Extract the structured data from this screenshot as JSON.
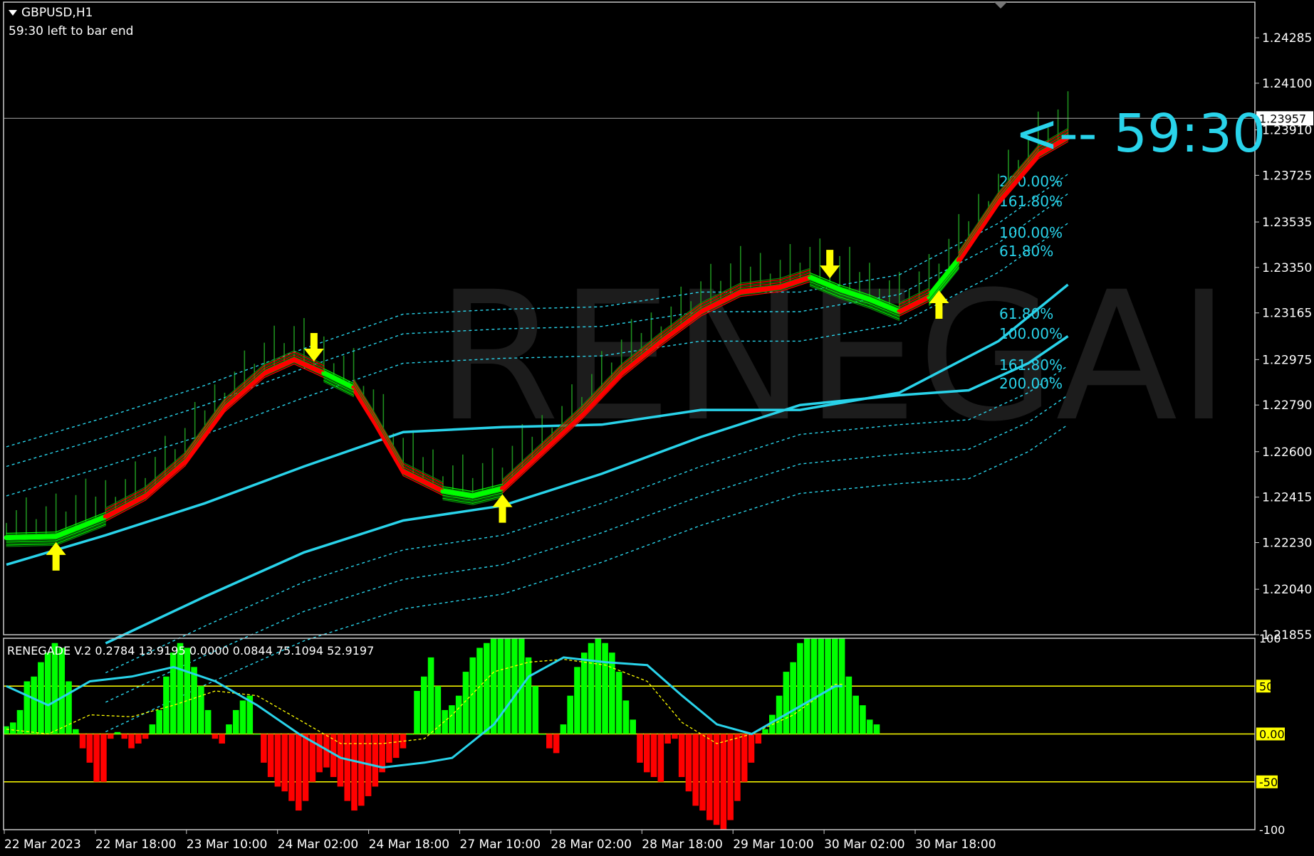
{
  "header": {
    "symbol_label": "GBPUSD,H1",
    "timer_label": "59:30 left to bar end"
  },
  "countdown_label": "<-- 59:30",
  "watermark": "RENEGAI",
  "colors": {
    "background": "#000000",
    "frame": "#c8c8c8",
    "bull": "#00ff00",
    "bear": "#ff0000",
    "band": "#29d3ea",
    "arrow": "#ffff00",
    "level_line": "#ffff00",
    "wick": "#1e8f1e",
    "watermark": "#1c1c1c"
  },
  "chart_data": [
    {
      "type": "line",
      "title": "GBPUSD,H1",
      "ylim": [
        1.21855,
        1.2443
      ],
      "y_ticks": [
        "1.24285",
        "1.24100",
        "1.23910",
        "1.23725",
        "1.23535",
        "1.23350",
        "1.23165",
        "1.22975",
        "1.22790",
        "1.22600",
        "1.22415",
        "1.22230",
        "1.22040",
        "1.21855"
      ],
      "current_price": "1.23957",
      "x_ticks": [
        "22 Mar 2023",
        "22 Mar 18:00",
        "23 Mar 10:00",
        "24 Mar 02:00",
        "24 Mar 18:00",
        "27 Mar 10:00",
        "28 Mar 02:00",
        "28 Mar 18:00",
        "29 Mar 10:00",
        "30 Mar 02:00",
        "30 Mar 18:00"
      ],
      "ribbon": [
        {
          "x": 0,
          "y": 1.2225,
          "trend": "bull"
        },
        {
          "x": 5,
          "y": 1.22255,
          "trend": "bull"
        },
        {
          "x": 10,
          "y": 1.22335,
          "trend": "bear"
        },
        {
          "x": 14,
          "y": 1.2242,
          "trend": "bear"
        },
        {
          "x": 18,
          "y": 1.2256,
          "trend": "bear"
        },
        {
          "x": 22,
          "y": 1.2278,
          "trend": "bear"
        },
        {
          "x": 26,
          "y": 1.2292,
          "trend": "bear"
        },
        {
          "x": 29,
          "y": 1.22975,
          "trend": "bear"
        },
        {
          "x": 32,
          "y": 1.2292,
          "trend": "bull"
        },
        {
          "x": 35,
          "y": 1.2286,
          "trend": "bear"
        },
        {
          "x": 37,
          "y": 1.2273,
          "trend": "bear"
        },
        {
          "x": 40,
          "y": 1.2252,
          "trend": "bear"
        },
        {
          "x": 44,
          "y": 1.2244,
          "trend": "bull"
        },
        {
          "x": 47,
          "y": 1.2242,
          "trend": "bull"
        },
        {
          "x": 50,
          "y": 1.2245,
          "trend": "bear"
        },
        {
          "x": 54,
          "y": 1.226,
          "trend": "bear"
        },
        {
          "x": 58,
          "y": 1.2275,
          "trend": "bear"
        },
        {
          "x": 62,
          "y": 1.2292,
          "trend": "bear"
        },
        {
          "x": 66,
          "y": 1.2305,
          "trend": "bear"
        },
        {
          "x": 70,
          "y": 1.2317,
          "trend": "bear"
        },
        {
          "x": 74,
          "y": 1.2325,
          "trend": "bear"
        },
        {
          "x": 78,
          "y": 1.2327,
          "trend": "bear"
        },
        {
          "x": 81,
          "y": 1.2331,
          "trend": "bull"
        },
        {
          "x": 84,
          "y": 1.2326,
          "trend": "bull"
        },
        {
          "x": 87,
          "y": 1.2322,
          "trend": "bull"
        },
        {
          "x": 90,
          "y": 1.2317,
          "trend": "bear"
        },
        {
          "x": 93,
          "y": 1.2323,
          "trend": "bull"
        },
        {
          "x": 96,
          "y": 1.2338,
          "trend": "bear"
        },
        {
          "x": 100,
          "y": 1.2362,
          "trend": "bear"
        },
        {
          "x": 104,
          "y": 1.2381,
          "trend": "bear"
        },
        {
          "x": 107,
          "y": 1.2388,
          "trend": "bear"
        }
      ],
      "bands": [
        {
          "name": "200.00%",
          "points": [
            [
              0,
              1.2262
            ],
            [
              10,
              1.2274
            ],
            [
              20,
              1.2287
            ],
            [
              30,
              1.2302
            ],
            [
              40,
              1.2316
            ],
            [
              50,
              1.2318
            ],
            [
              60,
              1.2319
            ],
            [
              70,
              1.2325
            ],
            [
              80,
              1.2325
            ],
            [
              90,
              1.2332
            ],
            [
              100,
              1.2353
            ],
            [
              107,
              1.2373
            ]
          ]
        },
        {
          "name": "161.80%",
          "points": [
            [
              0,
              1.2254
            ],
            [
              10,
              1.2266
            ],
            [
              20,
              1.2279
            ],
            [
              30,
              1.2294
            ],
            [
              40,
              1.2308
            ],
            [
              50,
              1.231
            ],
            [
              60,
              1.2311
            ],
            [
              70,
              1.2317
            ],
            [
              80,
              1.2317
            ],
            [
              90,
              1.2324
            ],
            [
              100,
              1.2345
            ],
            [
              107,
              1.2365
            ]
          ]
        },
        {
          "name": "100.00%",
          "points": [
            [
              0,
              1.2242
            ],
            [
              10,
              1.2254
            ],
            [
              20,
              1.2267
            ],
            [
              30,
              1.2282
            ],
            [
              40,
              1.2296
            ],
            [
              50,
              1.2298
            ],
            [
              60,
              1.2299
            ],
            [
              70,
              1.2305
            ],
            [
              80,
              1.2305
            ],
            [
              90,
              1.2312
            ],
            [
              100,
              1.2333
            ],
            [
              107,
              1.2353
            ]
          ]
        },
        {
          "name": "61.80%",
          "points": [
            [
              0,
              1.2214
            ],
            [
              10,
              1.2226
            ],
            [
              20,
              1.2239
            ],
            [
              30,
              1.2254
            ],
            [
              40,
              1.2268
            ],
            [
              50,
              1.227
            ],
            [
              60,
              1.2271
            ],
            [
              70,
              1.2277
            ],
            [
              80,
              1.2277
            ],
            [
              90,
              1.2284
            ],
            [
              100,
              1.2305
            ],
            [
              107,
              1.2328
            ]
          ]
        },
        {
          "name": "61.80%",
          "points": [
            [
              10,
              1.2182
            ],
            [
              20,
              1.2201
            ],
            [
              30,
              1.2219
            ],
            [
              40,
              1.2232
            ],
            [
              50,
              1.2238
            ],
            [
              60,
              1.2251
            ],
            [
              70,
              1.2266
            ],
            [
              80,
              1.2279
            ],
            [
              90,
              1.2283
            ],
            [
              97,
              1.2285
            ],
            [
              103,
              1.2296
            ],
            [
              107,
              1.2307
            ]
          ]
        },
        {
          "name": "100.00%",
          "points": [
            [
              10,
              1.217
            ],
            [
              20,
              1.2189
            ],
            [
              30,
              1.2207
            ],
            [
              40,
              1.222
            ],
            [
              50,
              1.2226
            ],
            [
              60,
              1.2239
            ],
            [
              70,
              1.2254
            ],
            [
              80,
              1.2267
            ],
            [
              90,
              1.2271
            ],
            [
              97,
              1.2273
            ],
            [
              103,
              1.2284
            ],
            [
              107,
              1.2295
            ]
          ]
        },
        {
          "name": "161.80%",
          "points": [
            [
              10,
              1.2158
            ],
            [
              20,
              1.2177
            ],
            [
              30,
              1.2195
            ],
            [
              40,
              1.2208
            ],
            [
              50,
              1.2214
            ],
            [
              60,
              1.2227
            ],
            [
              70,
              1.2242
            ],
            [
              80,
              1.2255
            ],
            [
              90,
              1.2259
            ],
            [
              97,
              1.2261
            ],
            [
              103,
              1.2272
            ],
            [
              107,
              1.2283
            ]
          ]
        },
        {
          "name": "200.00%",
          "points": [
            [
              10,
              1.2146
            ],
            [
              20,
              1.2165
            ],
            [
              30,
              1.2183
            ],
            [
              40,
              1.2196
            ],
            [
              50,
              1.2202
            ],
            [
              60,
              1.2215
            ],
            [
              70,
              1.223
            ],
            [
              80,
              1.2243
            ],
            [
              90,
              1.2247
            ],
            [
              97,
              1.2249
            ],
            [
              103,
              1.226
            ],
            [
              107,
              1.2271
            ]
          ]
        }
      ],
      "band_labels": [
        "200.00%",
        "161.80%",
        "100.00%",
        "61.80%",
        "61.80%",
        "100.00%",
        "161.80%",
        "200.00%"
      ],
      "signals": [
        {
          "x": 5,
          "dir": "up"
        },
        {
          "x": 31,
          "dir": "down"
        },
        {
          "x": 50,
          "dir": "up"
        },
        {
          "x": 83,
          "dir": "down"
        },
        {
          "x": 94,
          "dir": "up"
        }
      ]
    },
    {
      "type": "bar",
      "title": "RENEGADE V.2 0.2784 13.9195 0.0000 0.0844 75.1094 52.9197",
      "ylim": [
        -100,
        100
      ],
      "y_ticks": [
        "100",
        "50",
        "0.00",
        "-50",
        "-100"
      ],
      "levels": [
        50,
        0,
        -50
      ],
      "values": [
        8,
        12,
        25,
        55,
        60,
        75,
        85,
        95,
        90,
        55,
        5,
        -15,
        -30,
        -50,
        -50,
        -5,
        2,
        -5,
        -15,
        -10,
        -5,
        10,
        25,
        60,
        85,
        95,
        90,
        70,
        50,
        25,
        -5,
        -10,
        10,
        25,
        35,
        40,
        0,
        -30,
        -45,
        -55,
        -60,
        -70,
        -80,
        -70,
        -50,
        -40,
        -35,
        -45,
        -55,
        -70,
        -80,
        -75,
        -65,
        -55,
        -40,
        -30,
        -25,
        -15,
        0,
        45,
        60,
        80,
        50,
        25,
        30,
        40,
        65,
        80,
        90,
        95,
        100,
        100,
        100,
        100,
        100,
        80,
        50,
        0,
        -15,
        -20,
        10,
        40,
        70,
        85,
        95,
        100,
        95,
        85,
        65,
        35,
        15,
        -30,
        -40,
        -45,
        -50,
        -10,
        -5,
        -45,
        -60,
        -75,
        -80,
        -90,
        -95,
        -100,
        -90,
        -70,
        -50,
        -30,
        -10,
        5,
        20,
        40,
        65,
        75,
        95,
        100,
        100,
        100,
        100,
        100,
        100,
        60,
        40,
        30,
        15,
        10
      ],
      "signal_line": [
        [
          0,
          5
        ],
        [
          6,
          0
        ],
        [
          12,
          20
        ],
        [
          18,
          18
        ],
        [
          24,
          30
        ],
        [
          30,
          45
        ],
        [
          36,
          40
        ],
        [
          42,
          15
        ],
        [
          48,
          -10
        ],
        [
          54,
          -10
        ],
        [
          60,
          -5
        ],
        [
          64,
          20
        ],
        [
          70,
          65
        ],
        [
          75,
          75
        ],
        [
          80,
          78
        ],
        [
          86,
          72
        ],
        [
          92,
          55
        ],
        [
          97,
          12
        ],
        [
          102,
          -10
        ],
        [
          107,
          0
        ],
        [
          113,
          20
        ],
        [
          119,
          52
        ],
        [
          120,
          52
        ]
      ],
      "fast_line": [
        [
          0,
          50
        ],
        [
          6,
          30
        ],
        [
          12,
          55
        ],
        [
          18,
          60
        ],
        [
          24,
          70
        ],
        [
          30,
          55
        ],
        [
          36,
          30
        ],
        [
          42,
          0
        ],
        [
          48,
          -25
        ],
        [
          54,
          -35
        ],
        [
          60,
          -30
        ],
        [
          64,
          -25
        ],
        [
          70,
          10
        ],
        [
          75,
          60
        ],
        [
          80,
          80
        ],
        [
          86,
          75
        ],
        [
          92,
          72
        ],
        [
          97,
          40
        ],
        [
          102,
          10
        ],
        [
          107,
          0
        ],
        [
          113,
          25
        ],
        [
          119,
          50
        ],
        [
          120,
          50
        ]
      ]
    }
  ]
}
